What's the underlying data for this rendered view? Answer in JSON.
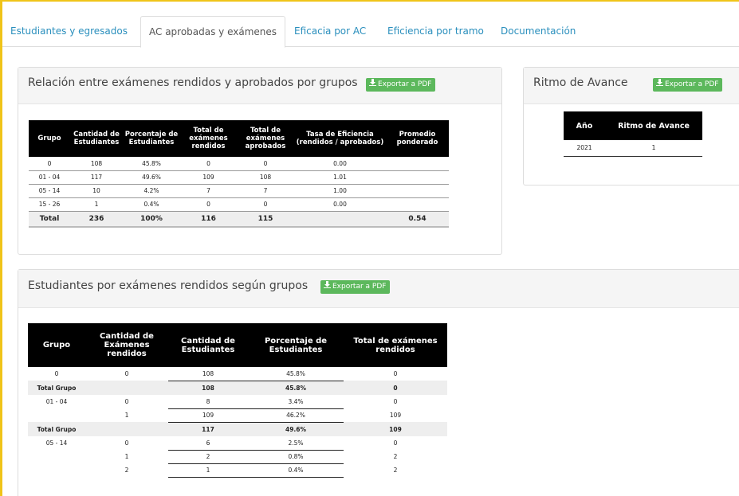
{
  "tabs": [
    {
      "label": "Estudiantes y egresados"
    },
    {
      "label": "AC aprobadas y exámenes"
    },
    {
      "label": "Eficacia por AC"
    },
    {
      "label": "Eficiencia por tramo"
    },
    {
      "label": "Documentación"
    }
  ],
  "export_label": "Exportar a PDF",
  "panel1": {
    "title": "Relación entre exámenes rendidos y aprobados por grupos",
    "headers": [
      "Grupo",
      "Cantidad de Estudiantes",
      "Porcentaje de Estudiantes",
      "Total de exámenes rendidos",
      "Total de exámenes aprobados",
      "Tasa de Eficiencia (rendidos / aprobados)",
      "Promedio ponderado"
    ],
    "rows": [
      [
        "0",
        "108",
        "45.8%",
        "0",
        "0",
        "0.00",
        ""
      ],
      [
        "01 - 04",
        "117",
        "49.6%",
        "109",
        "108",
        "1.01",
        ""
      ],
      [
        "05 - 14",
        "10",
        "4.2%",
        "7",
        "7",
        "1.00",
        ""
      ],
      [
        "15 - 26",
        "1",
        "0.4%",
        "0",
        "0",
        "0.00",
        ""
      ]
    ],
    "total": [
      "Total",
      "236",
      "100%",
      "116",
      "115",
      "",
      "0.54"
    ]
  },
  "panel2": {
    "title": "Ritmo de Avance",
    "headers": [
      "Año",
      "Ritmo de Avance"
    ],
    "rows": [
      [
        "2021",
        "1"
      ]
    ]
  },
  "panel3": {
    "title": "Estudiantes por exámenes rendidos según grupos",
    "headers": [
      "Grupo",
      "Cantidad de Exámenes rendidos",
      "Cantidad de Estudiantes",
      "Porcentaje de Estudiantes",
      "Total de exámenes rendidos"
    ],
    "rows": [
      {
        "type": "row",
        "cells": [
          "0",
          "0",
          "108",
          "45.8%",
          "0"
        ]
      },
      {
        "type": "total",
        "cells": [
          "Total Grupo",
          "",
          "108",
          "45.8%",
          "0"
        ]
      },
      {
        "type": "row",
        "cells": [
          "01 - 04",
          "0",
          "8",
          "3.4%",
          "0"
        ]
      },
      {
        "type": "row",
        "cells": [
          "",
          "1",
          "109",
          "46.2%",
          "109"
        ]
      },
      {
        "type": "total",
        "cells": [
          "Total Grupo",
          "",
          "117",
          "49.6%",
          "109"
        ]
      },
      {
        "type": "row",
        "cells": [
          "05 - 14",
          "0",
          "6",
          "2.5%",
          "0"
        ]
      },
      {
        "type": "row",
        "cells": [
          "",
          "1",
          "2",
          "0.8%",
          "2"
        ]
      },
      {
        "type": "row",
        "cells": [
          "",
          "2",
          "1",
          "0.4%",
          "2"
        ]
      }
    ]
  },
  "colors": {
    "accent": "#2a8fbd",
    "export": "#5cb85c",
    "frame": "#f0c419",
    "header": "#000000"
  },
  "icons": {
    "export": "download-icon"
  }
}
